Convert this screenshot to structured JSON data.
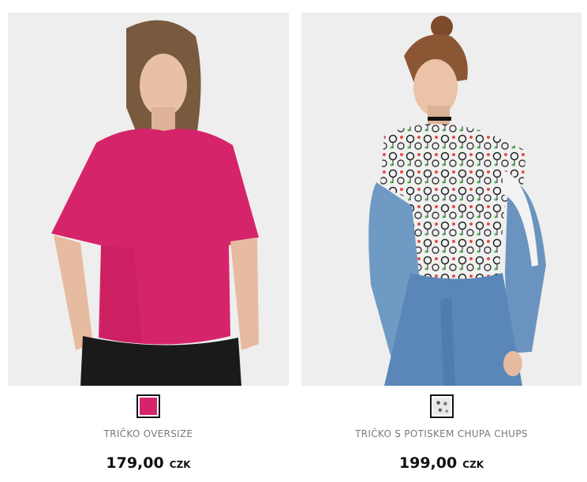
{
  "products": [
    {
      "name": "TRIČKO OVERSIZE",
      "price": "179,00",
      "currency": "CZK",
      "swatch_color": "#d6246a",
      "image_icon": "model-photo-pink-tshirt-icon"
    },
    {
      "name": "TRIČKO S POTISKEM CHUPA CHUPS",
      "price": "199,00",
      "currency": "CZK",
      "swatch_color": "#e6e6e6",
      "image_icon": "model-photo-print-tshirt-icon"
    }
  ],
  "colors": {
    "pink": "#d6246a",
    "denim": "#6f9ac4",
    "photo_bg": "#efefef"
  }
}
